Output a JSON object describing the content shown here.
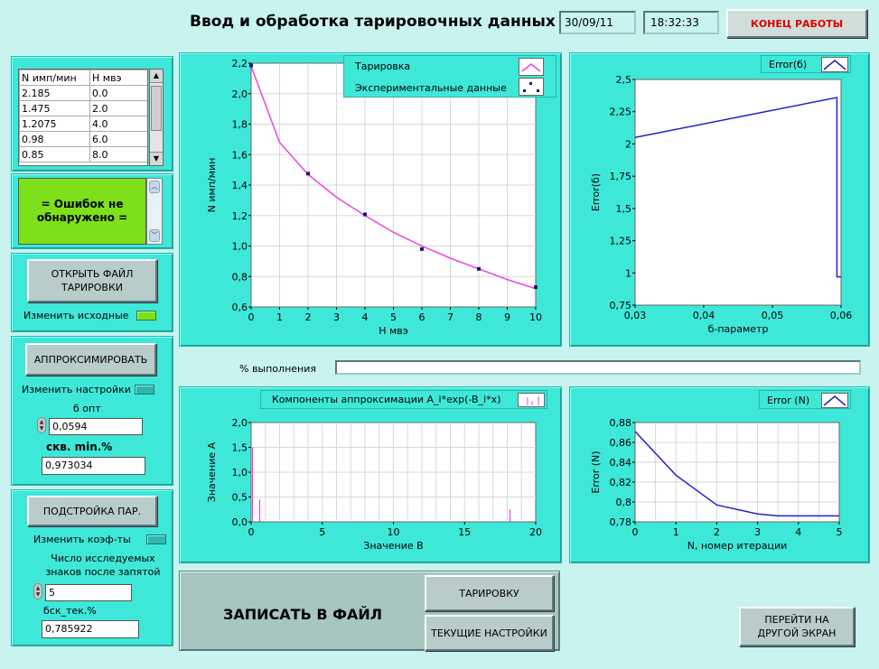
{
  "header": {
    "title": "Ввод и обработка тарировочных данных",
    "date": "30/09/11",
    "time": "18:32:33",
    "exit_button": "КОНЕЦ РАБОТЫ"
  },
  "data_table": {
    "columns": [
      "N имп/мин",
      "H мвэ"
    ],
    "rows": [
      [
        "2.185",
        "0.0"
      ],
      [
        "1.475",
        "2.0"
      ],
      [
        "1.2075",
        "4.0"
      ],
      [
        "0.98",
        "6.0"
      ],
      [
        "0.85",
        "8.0"
      ]
    ]
  },
  "status": {
    "message": "= Ошибок не обнаружено ="
  },
  "open_file": {
    "button": "ОТКРЫТЬ ФАЙЛ ТАРИРОВКИ",
    "toggle_label": "Изменить исходные"
  },
  "approx": {
    "button": "АППРОКСИМИРОВАТЬ",
    "toggle_label": "Изменить настройки",
    "b_opt_label": "б опт",
    "b_opt_value": "0,0594",
    "rms_label": "скв. min.%",
    "rms_value": "0,973034"
  },
  "tune": {
    "button": "ПОДСТРОЙКА ПАР.",
    "toggle_label": "Изменить коэф-ты",
    "digits_label": "Число исследуемых знаков после запятой",
    "digits_value": "5",
    "cur_label": "бск_тек.%",
    "cur_value": "0,785922"
  },
  "progress": {
    "label": "% выполнения",
    "value": 0
  },
  "save": {
    "label": "ЗАПИСАТЬ В ФАЙЛ",
    "btn_calibration": "ТАРИРОВКУ",
    "btn_settings": "ТЕКУЩИЕ НАСТРОЙКИ"
  },
  "goto_button": "ПЕРЕЙТИ НА ДРУГОЙ ЭКРАН",
  "colors": {
    "panel": "#3ee8d8",
    "background": "#c8f3ee",
    "magenta": "#ee44dd",
    "blue": "#2222cc",
    "navy": "#1a1a70"
  },
  "chart_data": [
    {
      "type": "line",
      "xlabel": "H мвэ",
      "ylabel": "N имп/мин",
      "xlim": [
        0,
        10
      ],
      "ylim": [
        0.6,
        2.2
      ],
      "xticks": [
        "0",
        "1",
        "2",
        "3",
        "4",
        "5",
        "6",
        "7",
        "8",
        "9",
        "10"
      ],
      "yticks": [
        "0,6",
        "0,8",
        "1,0",
        "1,2",
        "1,4",
        "1,6",
        "1,8",
        "2,0",
        "2,2"
      ],
      "legend": [
        "Тарировка",
        "Экспериментальные данные"
      ],
      "legend_position": "top",
      "series": [
        {
          "name": "Тарировка",
          "x": [
            0,
            1,
            2,
            3,
            4,
            5,
            6,
            7,
            8,
            9,
            10
          ],
          "y": [
            2.18,
            1.68,
            1.47,
            1.32,
            1.2,
            1.09,
            1.0,
            0.92,
            0.85,
            0.78,
            0.72
          ]
        },
        {
          "name": "Экспериментальные данные",
          "x": [
            0,
            2,
            4,
            6,
            8,
            10
          ],
          "y": [
            2.185,
            1.475,
            1.2075,
            0.98,
            0.85,
            0.73
          ]
        }
      ]
    },
    {
      "type": "line",
      "xlabel": "б-параметр",
      "ylabel": "Error(б)",
      "xlim": [
        0.03,
        0.06
      ],
      "ylim": [
        0.75,
        2.5
      ],
      "xticks": [
        "0,03",
        "0,04",
        "0,05",
        "0,06"
      ],
      "yticks": [
        "0,75",
        "1",
        "1,25",
        "1,5",
        "1,75",
        "2",
        "2,25",
        "2,5"
      ],
      "legend": [
        "Error(б)"
      ],
      "legend_position": "top-right",
      "series": [
        {
          "name": "Error(б)",
          "x": [
            0.03,
            0.0594,
            0.0594,
            0.06
          ],
          "y": [
            2.05,
            2.36,
            0.97,
            0.97
          ]
        }
      ]
    },
    {
      "type": "bar",
      "title": "Компоненты аппроксимации A_i*exp(-B_i*x)",
      "xlabel": "Значение B",
      "ylabel": "Значение A",
      "xlim": [
        0,
        20
      ],
      "ylim": [
        0,
        2.0
      ],
      "xticks": [
        "0",
        "5",
        "10",
        "15",
        "20"
      ],
      "yticks": [
        "0,0",
        "0,5",
        "1,0",
        "1,5",
        "2,0"
      ],
      "series": [
        {
          "x": [
            0.1,
            0.6,
            18.2
          ],
          "y": [
            1.5,
            0.45,
            0.25
          ]
        }
      ]
    },
    {
      "type": "line",
      "xlabel": "N, номер итерации",
      "ylabel": "Error (N)",
      "xlim": [
        0,
        5
      ],
      "ylim": [
        0.78,
        0.88
      ],
      "xticks": [
        "0",
        "1",
        "2",
        "3",
        "4",
        "5"
      ],
      "yticks": [
        "0,78",
        "0,8",
        "0,82",
        "0,84",
        "0,86",
        "0,88"
      ],
      "legend": [
        "Error (N)"
      ],
      "legend_position": "top-right",
      "series": [
        {
          "name": "Error (N)",
          "x": [
            0,
            1,
            2,
            3,
            3.5,
            4,
            5
          ],
          "y": [
            0.871,
            0.827,
            0.797,
            0.788,
            0.786,
            0.786,
            0.786
          ]
        }
      ]
    }
  ]
}
